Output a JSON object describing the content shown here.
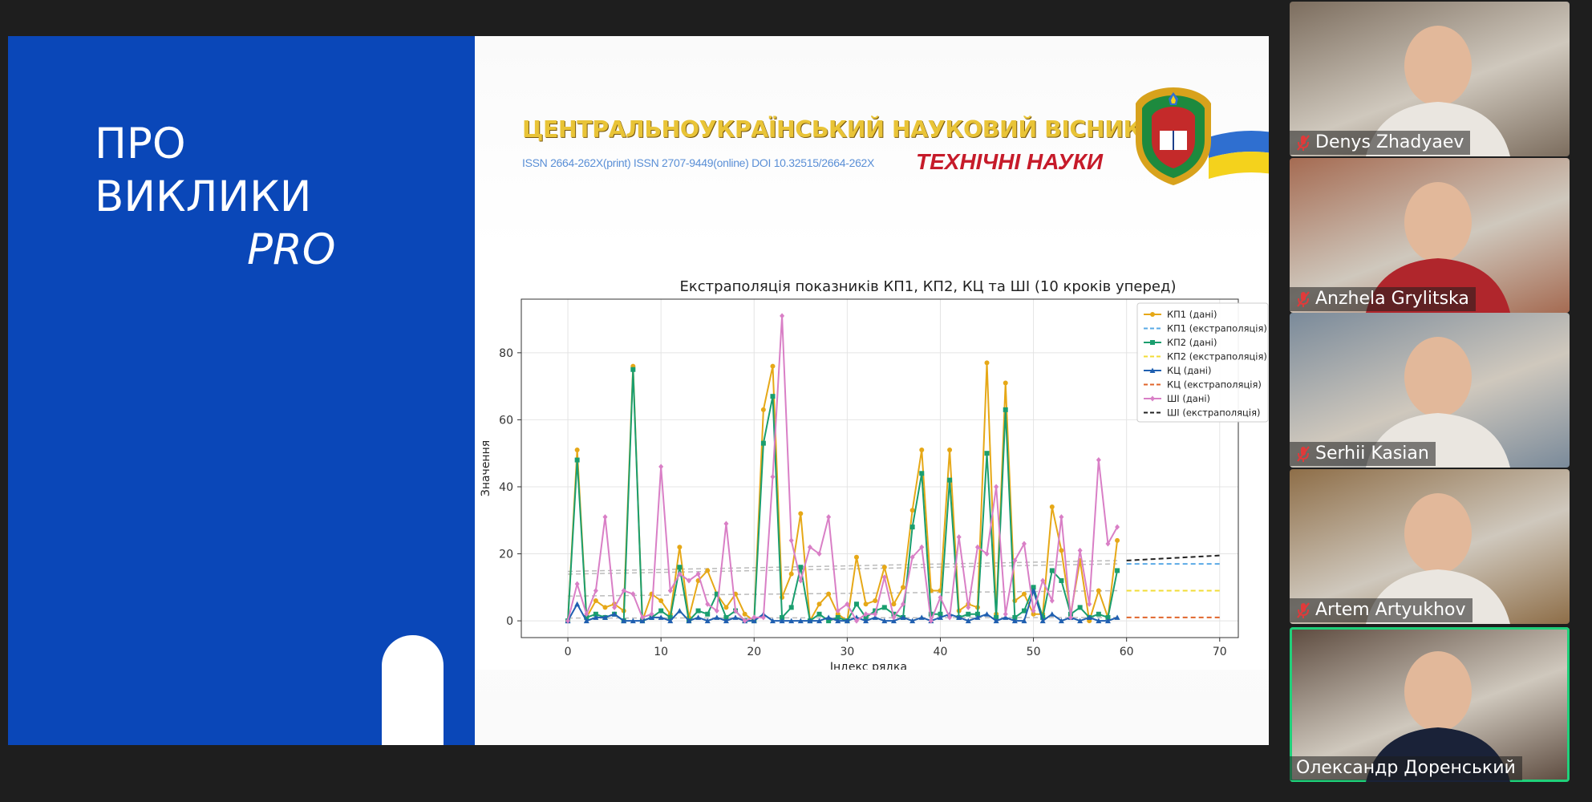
{
  "slide": {
    "title_line1": "ПРО",
    "title_line2": "ВИКЛИКИ",
    "title_line3": "PRO",
    "journal_name": "ЦЕНТРАЛЬНОУКРАЇНСЬКИЙ НАУКОВИЙ ВІСНИК",
    "journal_issn": "ISSN 2664-262X(print) ISSN 2707-9449(online) DOI 10.32515/2664-262X",
    "journal_subtitle": "ТЕХНІЧНІ НАУКИ"
  },
  "chart_data": {
    "type": "line",
    "title": "Екстраполяція показників КП1, КП2, КЦ та ШІ (10 кроків уперед)",
    "xlabel": "Індекс рядка",
    "ylabel": "Значення",
    "xlim": [
      -5,
      72
    ],
    "ylim": [
      -5,
      96
    ],
    "xticks": [
      0,
      10,
      20,
      30,
      40,
      50,
      60,
      70
    ],
    "yticks": [
      0,
      20,
      40,
      60,
      80
    ],
    "grid": true,
    "legend_position": "top-right",
    "x": [
      0,
      1,
      2,
      3,
      4,
      5,
      6,
      7,
      8,
      9,
      10,
      11,
      12,
      13,
      14,
      15,
      16,
      17,
      18,
      19,
      20,
      21,
      22,
      23,
      24,
      25,
      26,
      27,
      28,
      29,
      30,
      31,
      32,
      33,
      34,
      35,
      36,
      37,
      38,
      39,
      40,
      41,
      42,
      43,
      44,
      45,
      46,
      47,
      48,
      49,
      50,
      51,
      52,
      53,
      54,
      55,
      56,
      57,
      58,
      59
    ],
    "series": [
      {
        "name": "КП1 (дані)",
        "color": "#e6a817",
        "marker": "circle",
        "values": [
          0,
          51,
          1,
          6,
          4,
          5,
          3,
          76,
          0,
          8,
          6,
          2,
          22,
          1,
          12,
          15,
          8,
          4,
          8,
          2,
          0,
          63,
          76,
          7,
          14,
          32,
          0,
          5,
          8,
          2,
          0,
          19,
          5,
          6,
          16,
          5,
          10,
          33,
          51,
          9,
          9,
          51,
          3,
          5,
          4,
          77,
          2,
          71,
          6,
          8,
          2,
          2,
          34,
          21,
          2,
          18,
          0,
          9,
          1,
          24
        ]
      },
      {
        "name": "КП1 (екстраполяція)",
        "color": "#5aa9e6",
        "dashed": true,
        "ext_x": [
          60,
          70
        ],
        "ext_values": [
          17,
          17
        ]
      },
      {
        "name": "КП2 (дані)",
        "color": "#1a9e6e",
        "marker": "square",
        "values": [
          0,
          48,
          1,
          2,
          1,
          2,
          0,
          75,
          0,
          1,
          3,
          1,
          16,
          0,
          3,
          2,
          8,
          1,
          3,
          0,
          0,
          53,
          67,
          1,
          4,
          16,
          0,
          2,
          0,
          1,
          0,
          5,
          1,
          3,
          4,
          2,
          1,
          28,
          44,
          2,
          2,
          42,
          1,
          2,
          2,
          50,
          1,
          63,
          1,
          3,
          10,
          1,
          15,
          12,
          2,
          4,
          1,
          2,
          1,
          15
        ]
      },
      {
        "name": "КП2 (екстраполяція)",
        "color": "#f2dc35",
        "dashed": true,
        "ext_x": [
          60,
          70
        ],
        "ext_values": [
          9,
          9
        ]
      },
      {
        "name": "КЦ (дані)",
        "color": "#1f5fb0",
        "marker": "triangle",
        "values": [
          0,
          5,
          0,
          1,
          1,
          2,
          0,
          0,
          0,
          1,
          1,
          0,
          3,
          0,
          1,
          0,
          1,
          0,
          1,
          0,
          0,
          2,
          0,
          0,
          0,
          0,
          0,
          0,
          1,
          0,
          0,
          1,
          0,
          1,
          0,
          0,
          1,
          0,
          1,
          0,
          1,
          2,
          1,
          0,
          1,
          2,
          0,
          1,
          0,
          0,
          9,
          0,
          2,
          0,
          1,
          0,
          1,
          0,
          0,
          1
        ]
      },
      {
        "name": "КЦ (екстраполяція)",
        "color": "#e0652b",
        "dashed": true,
        "ext_x": [
          60,
          70
        ],
        "ext_values": [
          1,
          1
        ]
      },
      {
        "name": "ШІ (дані)",
        "color": "#d97fc6",
        "marker": "diamond",
        "values": [
          0,
          11,
          2,
          9,
          31,
          4,
          9,
          8,
          1,
          2,
          46,
          9,
          14,
          12,
          14,
          5,
          3,
          29,
          3,
          0,
          1,
          1,
          43,
          91,
          24,
          12,
          22,
          20,
          31,
          3,
          5,
          0,
          2,
          2,
          13,
          1,
          5,
          19,
          22,
          0,
          7,
          1,
          25,
          4,
          22,
          20,
          40,
          2,
          18,
          23,
          3,
          12,
          6,
          31,
          1,
          21,
          5,
          48,
          23,
          28
        ]
      },
      {
        "name": "ШІ (екстраполяція)",
        "color": "#222222",
        "dashed": true,
        "ext_x": [
          60,
          70
        ],
        "ext_values": [
          18,
          19.5
        ]
      }
    ]
  },
  "participants": [
    {
      "name": "Denys Zhadyaev",
      "muted": true,
      "active": false,
      "bg": "#7c6d5e"
    },
    {
      "name": "Anzhela Grylitska",
      "muted": true,
      "active": false,
      "bg": "#a56b52"
    },
    {
      "name": "Serhii Kasian",
      "muted": true,
      "active": false,
      "bg": "#7a8a9a"
    },
    {
      "name": "Artem Artyukhov",
      "muted": true,
      "active": false,
      "bg": "#8e6e48"
    },
    {
      "name": "Олександр Доренський",
      "muted": false,
      "active": true,
      "bg": "#5c4a3e"
    }
  ]
}
